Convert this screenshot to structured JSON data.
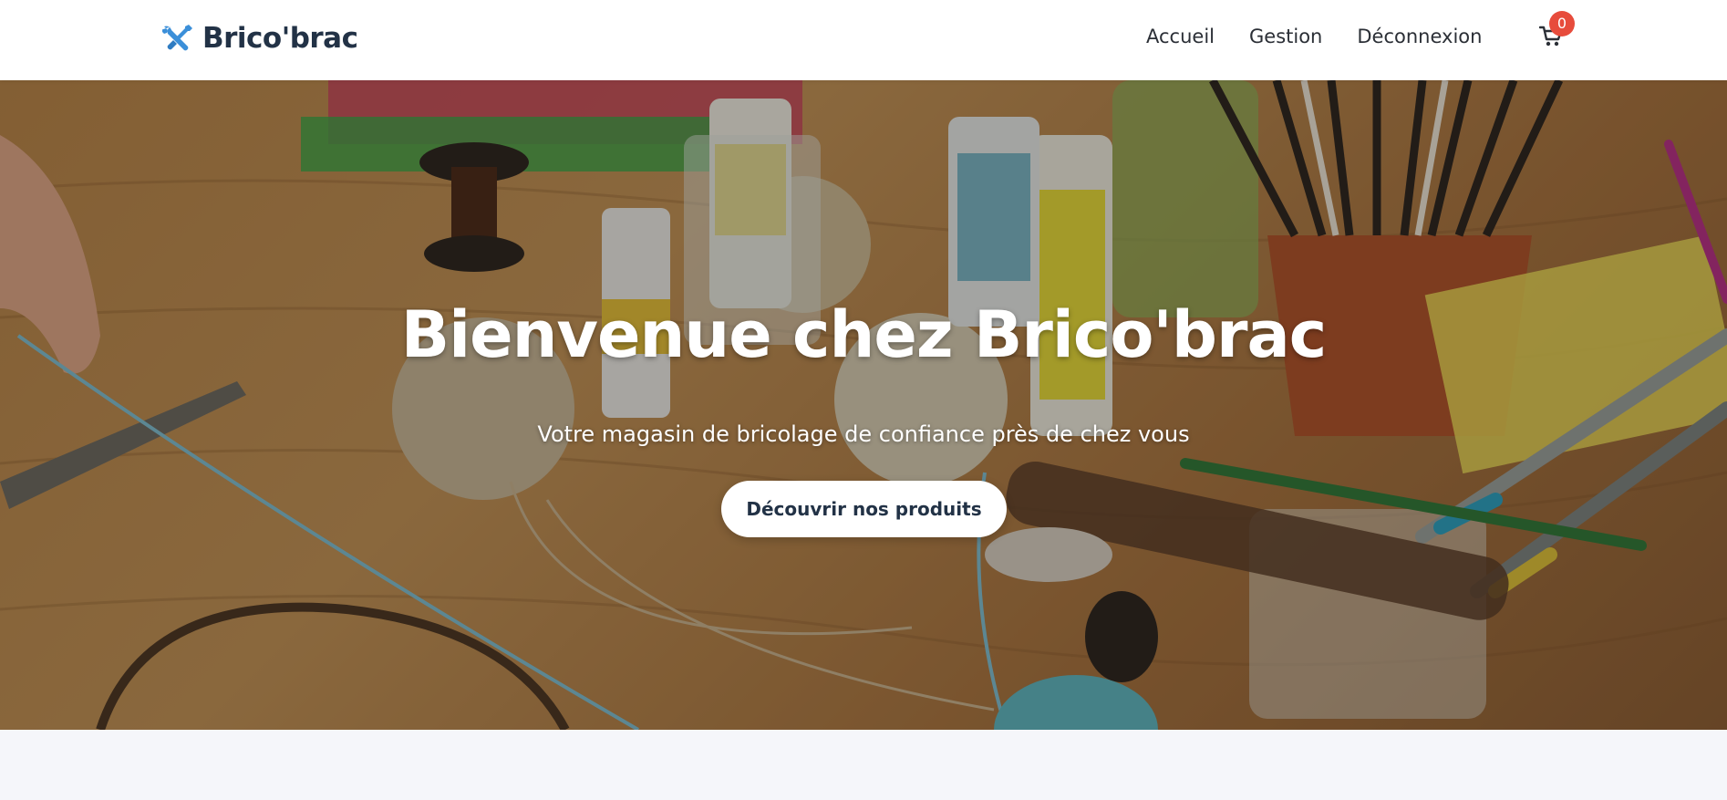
{
  "navbar": {
    "brand": {
      "name": "Brico'brac",
      "icon": "tools-icon",
      "icon_color": "#3b8fd9"
    },
    "links": [
      {
        "label": "Accueil"
      },
      {
        "label": "Gestion"
      },
      {
        "label": "Déconnexion"
      }
    ],
    "cart": {
      "icon": "cart-icon",
      "count": "0",
      "badge_color": "#e74c3c"
    }
  },
  "hero": {
    "title": "Bienvenue chez Brico'brac",
    "subtitle": "Votre magasin de bricolage de confiance près de chez vous",
    "cta_label": "Découvrir nos produits",
    "background": "craft-table-photo"
  },
  "colors": {
    "brand_text": "#223246",
    "accent": "#3b8fd9",
    "page_bg": "#f5f6fa"
  }
}
